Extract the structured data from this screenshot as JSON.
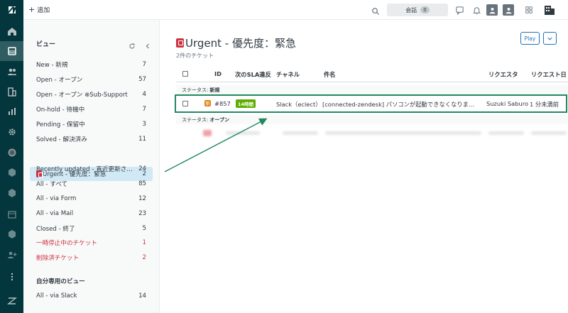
{
  "topbar": {
    "add_label": "追加",
    "conversations_label": "会話",
    "conversations_count": "0"
  },
  "rail": {
    "icons": [
      "zendesk-logo-icon",
      "home-icon",
      "views-icon",
      "customers-icon",
      "organizations-icon",
      "reporting-icon",
      "admin-gear-icon",
      "app-icon",
      "app-icon-2",
      "app-icon-3",
      "calendar-icon",
      "app-icon-4",
      "add-user-icon",
      "more-icon",
      "zendesk-products-icon"
    ]
  },
  "views": {
    "heading": "ビュー",
    "items": [
      {
        "label": "New - 新規",
        "count": "7"
      },
      {
        "label": "Open - オープン",
        "count": "57"
      },
      {
        "label": "Open - オープン ⊗Sub-Support",
        "count": "4"
      },
      {
        "label": "On-hold - 待機中",
        "count": "7"
      },
      {
        "label": "Pending - 保留中",
        "count": "3"
      },
      {
        "label": "Solved - 解決済み",
        "count": "11"
      },
      {
        "label": "Urgent - 優先度：緊急",
        "count": "2"
      },
      {
        "label": "Recently updated - 直近更新されたチケット",
        "count": "24"
      },
      {
        "label": "All - すべて",
        "count": "85"
      },
      {
        "label": "All - via Form",
        "count": "12"
      },
      {
        "label": "All - via Mail",
        "count": "23"
      },
      {
        "label": "Closed - 終了",
        "count": "5"
      },
      {
        "label": "一時停止中のチケット",
        "count": "1"
      },
      {
        "label": "削除済チケット",
        "count": "2"
      }
    ],
    "personal_heading": "自分専用のビュー",
    "personal_items": [
      {
        "label": "All - via Slack",
        "count": "14"
      }
    ]
  },
  "main": {
    "title": "Urgent - 優先度：緊急",
    "subtitle": "2件のチケット",
    "play_label": "Play",
    "columns": [
      "ID",
      "次のSLA違反",
      "チャネル",
      "件名",
      "リクエスタ",
      "リクエスト日"
    ],
    "groups": [
      {
        "prefix": "ステータス:",
        "status": "新規"
      },
      {
        "prefix": "ステータス:",
        "status": "オープン"
      }
    ],
    "ticket": {
      "status_letter": "新",
      "id": "#857",
      "sla": "14時間",
      "channel": "Slack（eclect）",
      "subject": "[connected-zendesk] パソコンが起動できなくなりました: ...",
      "requester": "Suzuki Saburo",
      "requested": "1 分未満前"
    }
  },
  "colors": {
    "rail": "#03363d",
    "selected_view": "#d1e8f5",
    "highlight": "#1f8a5e",
    "sla_badge": "#5eae00",
    "new_badge": "#e38215",
    "urgent": "#cc3340"
  }
}
